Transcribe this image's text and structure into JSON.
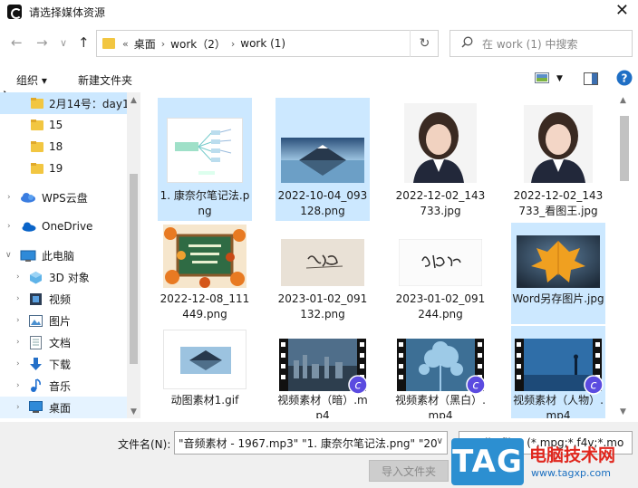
{
  "window": {
    "title": "请选择媒体资源",
    "close_icon": "close-icon"
  },
  "nav": {
    "back": "←",
    "forward": "→",
    "dropdown": "∨",
    "up": "↑",
    "crumb_prefix": "«",
    "breadcrumbs": [
      "桌面",
      "work（2）",
      "work (1)"
    ],
    "breadcrumb_sep": "›",
    "refresh": "↻",
    "search_placeholder": "在 work (1) 中搜索"
  },
  "toolbar": {
    "organize": "组织 ▾",
    "new_folder": "新建文件夹",
    "help": "?"
  },
  "sidebar": {
    "items": [
      {
        "label": "2月14号：day1",
        "type": "folder",
        "state": "selected"
      },
      {
        "label": "15",
        "type": "folder"
      },
      {
        "label": "18",
        "type": "folder"
      },
      {
        "label": "19",
        "type": "folder"
      },
      {
        "label": "WPS云盘",
        "type": "cloud"
      },
      {
        "label": "OneDrive",
        "type": "onedrive"
      },
      {
        "label": "此电脑",
        "type": "pc"
      },
      {
        "label": "3D 对象",
        "type": "3d"
      },
      {
        "label": "视频",
        "type": "video"
      },
      {
        "label": "图片",
        "type": "pictures"
      },
      {
        "label": "文档",
        "type": "docs"
      },
      {
        "label": "下载",
        "type": "download"
      },
      {
        "label": "音乐",
        "type": "music"
      },
      {
        "label": "桌面",
        "type": "desktop",
        "state": "hover"
      }
    ]
  },
  "files": [
    {
      "name": "1. 康奈尔笔记法.png",
      "kind": "mindmap",
      "selected": true
    },
    {
      "name": "2022-10-04_093128.png",
      "kind": "mountain",
      "selected": true
    },
    {
      "name": "2022-12-02_143733.jpg",
      "kind": "portrait",
      "selected": false
    },
    {
      "name": "2022-12-02_143733_看图王.jpg",
      "kind": "portrait",
      "selected": false
    },
    {
      "name": "2022-12-08_111449.png",
      "kind": "chalkboard",
      "selected": false
    },
    {
      "name": "2023-01-02_091132.png",
      "kind": "signature",
      "selected": false
    },
    {
      "name": "2023-01-02_091244.png",
      "kind": "signature2",
      "selected": false
    },
    {
      "name": "Word另存图片.jpg",
      "kind": "leaf",
      "selected": true
    },
    {
      "name": "动图素材1.gif",
      "kind": "mountain-small",
      "selected": false
    },
    {
      "name": "视频素材（暗）.mp4",
      "kind": "video-city",
      "selected": false
    },
    {
      "name": "视频素材（黑白）.mp4",
      "kind": "video-tree",
      "selected": false
    },
    {
      "name": "视频素材（人物）.mp4",
      "kind": "video-person",
      "selected": true
    }
  ],
  "footer": {
    "filename_label": "文件名(N):",
    "filename_value": "\"音频素材 - 1967.mp3\" \"1. 康奈尔笔记法.png\" \"20",
    "filetype_value": "Media files (*.mpg;*.f4v;*.mo",
    "import_button": "导入文件夹"
  },
  "watermark": {
    "logo": "TAG",
    "site_name": "电脑技术网",
    "site_url": "www.tagxp.com"
  },
  "colors": {
    "selection": "#cce8ff",
    "folder": "#f2c641",
    "accent": "#2c8fd1"
  }
}
